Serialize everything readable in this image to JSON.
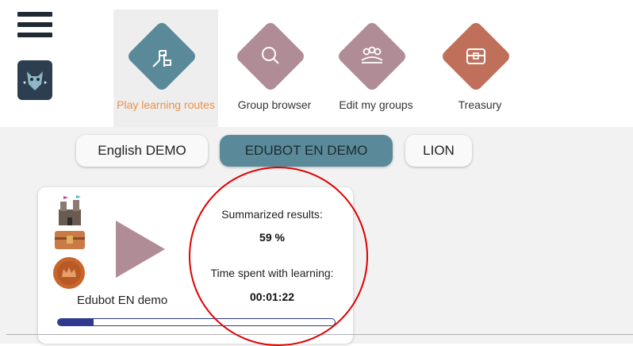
{
  "nav": {
    "items": [
      {
        "label": "Play learning routes",
        "color": "#5a8a99",
        "icon": "flags-icon"
      },
      {
        "label": "Group browser",
        "color": "#b08c96",
        "icon": "search-icon"
      },
      {
        "label": "Edit my groups",
        "color": "#b08c96",
        "icon": "group-icon"
      },
      {
        "label": "Treasury",
        "color": "#c0705a",
        "icon": "treasure-chest-icon"
      }
    ]
  },
  "tabs": [
    {
      "label": "English DEMO"
    },
    {
      "label": "EDUBOT EN DEMO"
    },
    {
      "label": "LION"
    }
  ],
  "card": {
    "route_name": "Edubot EN demo",
    "summary_label": "Summarized results:",
    "summary_value": "59 %",
    "time_label": "Time spent with learning:",
    "time_value": "00:01:22",
    "progress_fraction": 0.13
  }
}
